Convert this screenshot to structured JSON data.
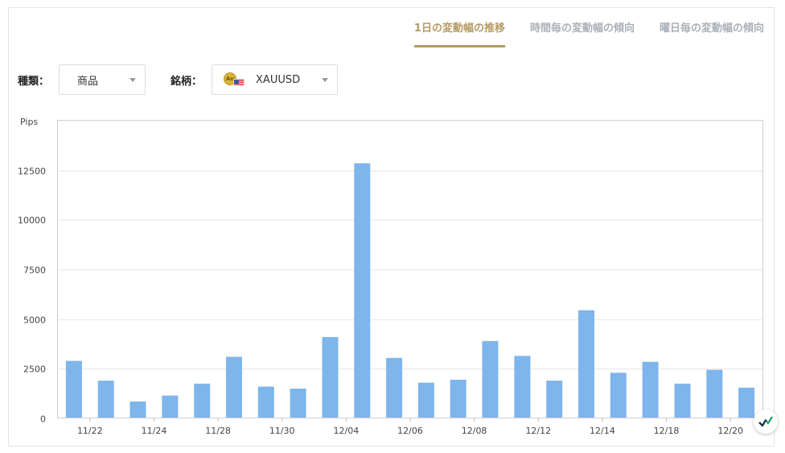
{
  "tabs": [
    {
      "label": "1日の変動幅の推移",
      "active": true
    },
    {
      "label": "時間毎の変動幅の傾向",
      "active": false
    },
    {
      "label": "曜日毎の変動幅の傾向",
      "active": false
    }
  ],
  "filters": {
    "type_label": "種類：",
    "type_value": "商品",
    "symbol_label": "銘柄：",
    "symbol_value": "XAUUSD",
    "symbol_icon": "gold-coin-usd-flag-icon",
    "coin_text": "Au"
  },
  "colors": {
    "bar": "#7eb5ea",
    "accent": "#b49a63",
    "grid": "#e6e6e6"
  },
  "chart_data": {
    "type": "bar",
    "title": "",
    "xlabel": "",
    "ylabel": "Pips",
    "ylim": [
      0,
      15000
    ],
    "yticks": [
      0,
      2500,
      5000,
      7500,
      10000,
      12500
    ],
    "grid": true,
    "categories": [
      "",
      "11/22",
      "",
      "11/24",
      "",
      "11/28",
      "",
      "11/30",
      "",
      "12/04",
      "",
      "12/06",
      "",
      "12/08",
      "",
      "12/12",
      "",
      "12/14",
      "",
      "12/18",
      "",
      "12/20"
    ],
    "values": [
      2900,
      1900,
      850,
      1150,
      1750,
      3100,
      1600,
      1500,
      4100,
      12850,
      3050,
      1800,
      1950,
      3900,
      3150,
      1900,
      5450,
      2300,
      2850,
      1750,
      2450,
      1550
    ]
  }
}
